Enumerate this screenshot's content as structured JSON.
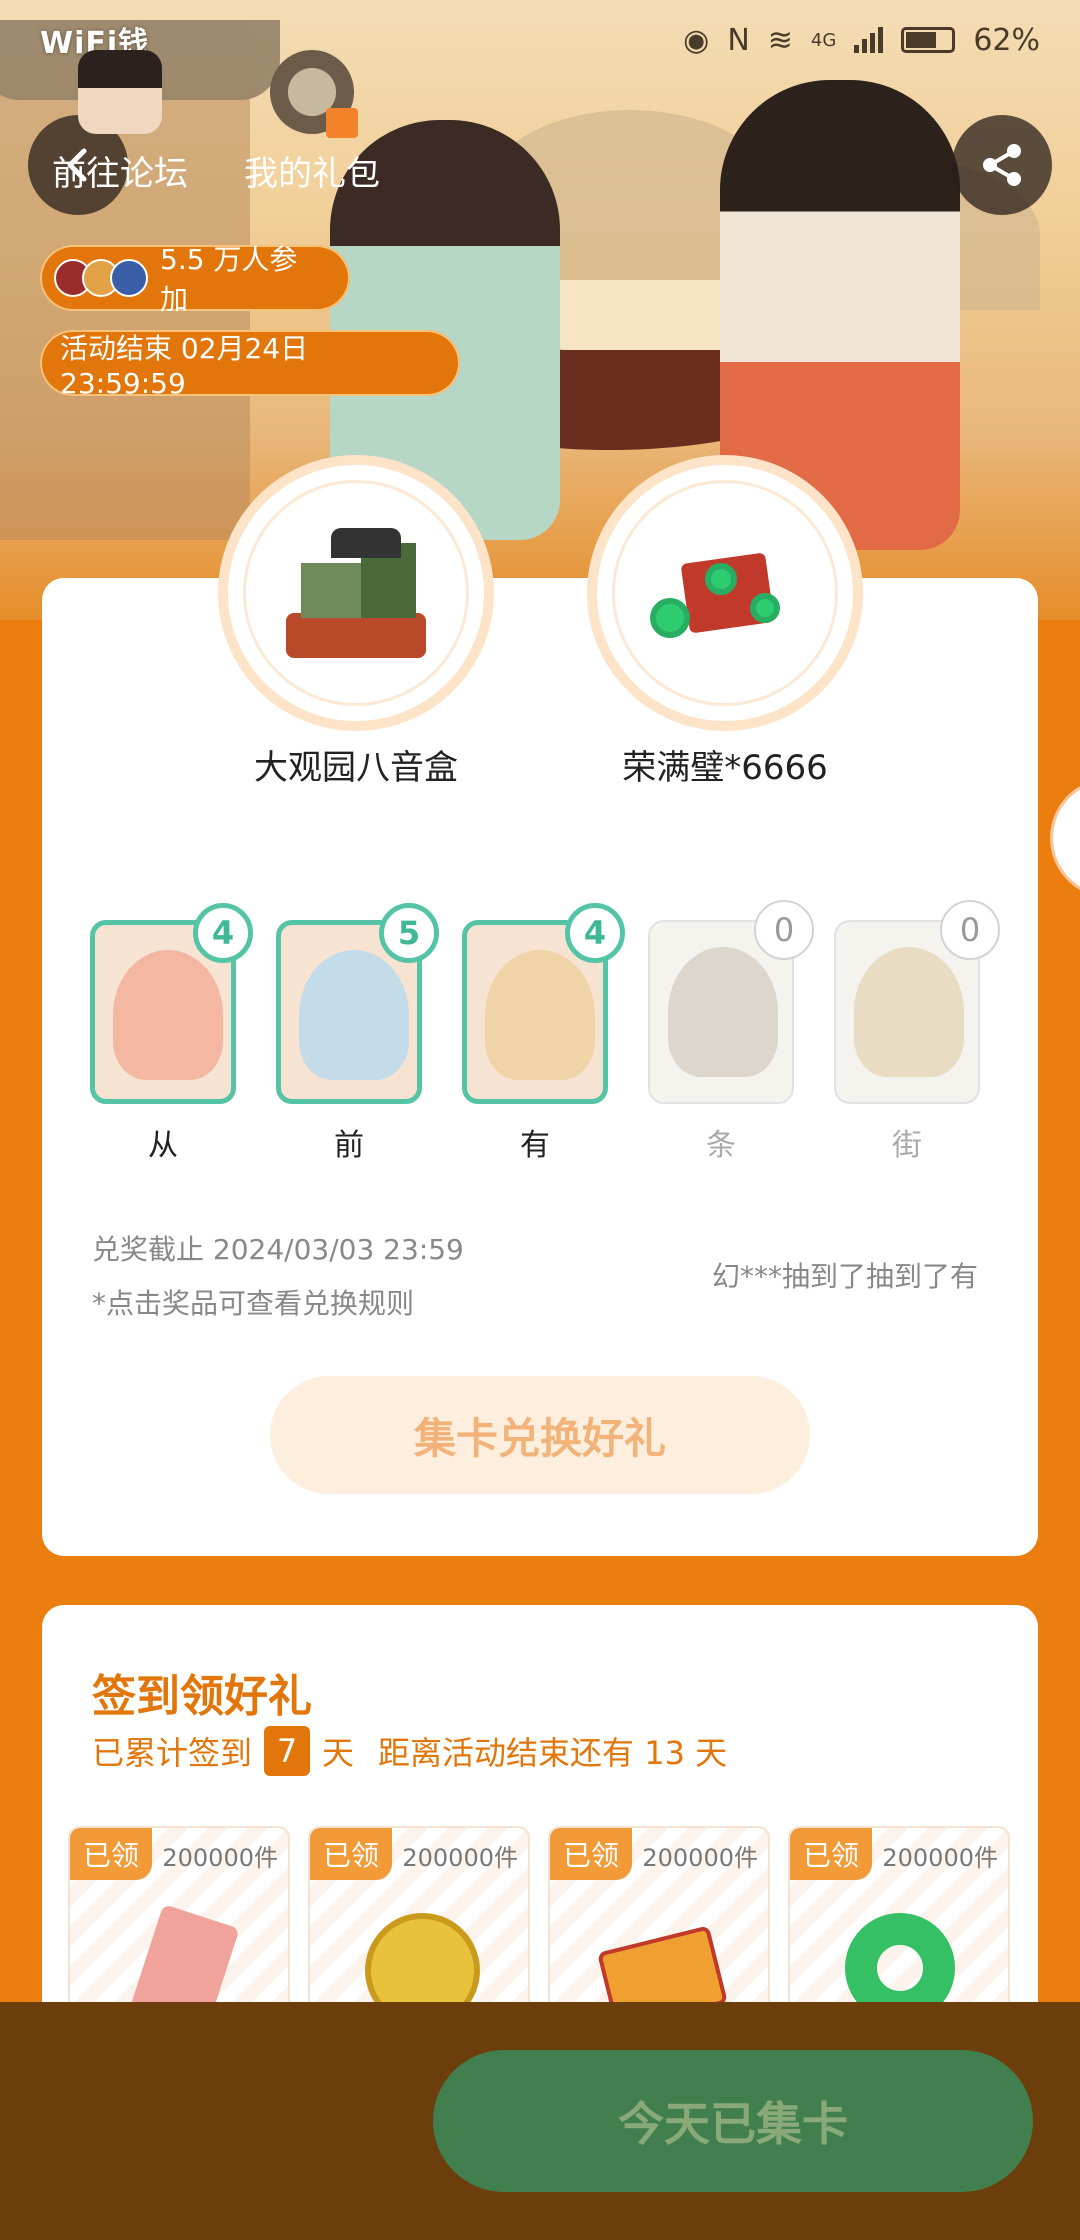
{
  "status_bar": {
    "brand": "WiFi钱",
    "network": "4G",
    "battery": "62%"
  },
  "header": {
    "participants": "5.5 万人参加",
    "event_end": "活动结束 02月24日 23:59:59"
  },
  "prizes": [
    {
      "label": "大观园八音盒",
      "icon": "music-box-icon"
    },
    {
      "label": "荣满璧*6666",
      "icon": "jade-chest-icon"
    }
  ],
  "cards": [
    {
      "name": "从",
      "count": "4",
      "owned": true,
      "color": "#f3b7a2"
    },
    {
      "name": "前",
      "count": "5",
      "owned": true,
      "color": "#c4dcea"
    },
    {
      "name": "有",
      "count": "4",
      "owned": true,
      "color": "#f1d3a8"
    },
    {
      "name": "条",
      "count": "0",
      "owned": false,
      "color": "#d6d0c4"
    },
    {
      "name": "街",
      "count": "0",
      "owned": false,
      "color": "#e4d6b8"
    }
  ],
  "info": {
    "deadline": "兑奖截止 2024/03/03 23:59",
    "rule_tip": "*点击奖品可查看兑换规则",
    "ticker": "幻***抽到了抽到了有"
  },
  "exchange_button": "集卡兑换好礼",
  "sign": {
    "title": "签到领好礼",
    "prefix": "已累计签到",
    "days": "7",
    "unit": "天",
    "remaining": "距离活动结束还有 13 天"
  },
  "rewards": [
    {
      "tag": "已领",
      "count": "200000件",
      "icon": "ticket-icon",
      "color": "#f0a39a"
    },
    {
      "tag": "已领",
      "count": "200000件",
      "icon": "pig-coin-icon",
      "color": "#e8c23a"
    },
    {
      "tag": "已领",
      "count": "200000件",
      "icon": "energy-ticket-icon",
      "color": "#f0a030"
    },
    {
      "tag": "已领",
      "count": "200000件",
      "icon": "jade-ring-icon",
      "color": "#35c065"
    }
  ],
  "bottom_nav": {
    "forum": "前往论坛",
    "gifts": "我的礼包",
    "main_button": "今天已集卡"
  },
  "colors": {
    "accent": "#e2760b",
    "teal": "#55c4a6",
    "green_button": "#427f4e",
    "bottom_bar": "#6b3e0c"
  }
}
